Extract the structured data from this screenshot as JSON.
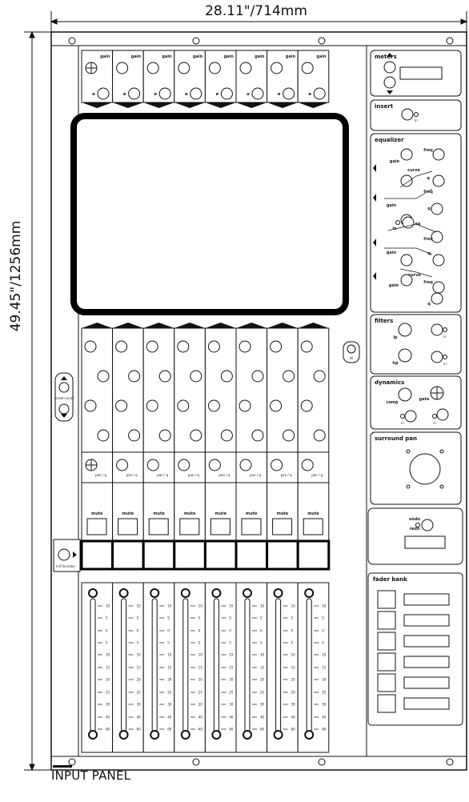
{
  "dimensions": {
    "width_label": "28.11\"/714mm",
    "height_label": "49.45\"/1256mm"
  },
  "caption": "INPUT PANEL",
  "channel_strip": {
    "top_knob_labels": [
      "gain",
      "gain",
      "gain",
      "gain",
      "gain",
      "gain",
      "gain",
      "gain"
    ],
    "phase_label": "ø",
    "pan_labels": [
      "pan / q",
      "pan / q",
      "pan / q",
      "pan / q",
      "pan / q",
      "pan / q",
      "pan / q",
      "pan / q"
    ],
    "mute_labels": [
      "mute",
      "mute",
      "mute",
      "mute",
      "mute",
      "mute",
      "mute",
      "mute"
    ],
    "fader_scale": [
      "10",
      "5",
      "0",
      "5",
      "10",
      "15",
      "20",
      "25",
      "30",
      "40",
      "60"
    ]
  },
  "left_controls": {
    "screen_scroll_label": "screen scroll",
    "lcd_function_label": "lcd function"
  },
  "center_button_label": "all",
  "right_sections": {
    "meters": {
      "title": "meters"
    },
    "insert": {
      "title": "insert",
      "in_label": "in"
    },
    "equalizer": {
      "title": "equalizer",
      "labels": [
        "gain",
        "freq",
        "curve",
        "q",
        "freq",
        "gain",
        "q",
        "in",
        "eq",
        "freq",
        "gain",
        "q",
        "curve",
        "gain",
        "freq",
        "q"
      ]
    },
    "filters": {
      "title": "filters",
      "labels": [
        "lp",
        "in",
        "hp",
        "in"
      ]
    },
    "dynamics": {
      "title": "dynamics",
      "labels": [
        "comp",
        "gate",
        "in",
        "in"
      ]
    },
    "surround_pan": {
      "title": "surround pan"
    },
    "undo": {
      "label1": "undo",
      "label2": "redo"
    },
    "fader_bank": {
      "title": "fader bank"
    }
  }
}
